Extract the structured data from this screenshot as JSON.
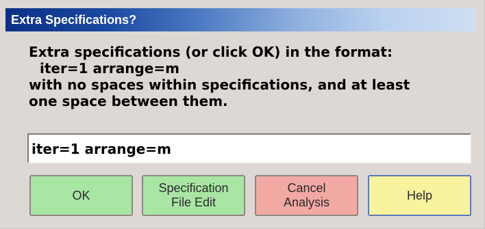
{
  "window": {
    "title": "Extra Specifications?"
  },
  "message": {
    "lines": [
      "Extra specifications (or click OK) in the format:",
      "iter=1 arrange=m",
      "with no spaces within specifications, and at least",
      "one space between them."
    ]
  },
  "input": {
    "value": "iter=1 arrange=m"
  },
  "buttons": {
    "ok": {
      "label": "OK",
      "color": "#a9e6a4"
    },
    "specification_file_edit": {
      "label_line1": "Specification",
      "label_line2": "File Edit",
      "color": "#a9e6a4"
    },
    "cancel_analysis": {
      "label_line1": "Cancel",
      "label_line2": "Analysis",
      "color": "#f2a9a4"
    },
    "help": {
      "label": "Help",
      "color": "#f8f39e"
    }
  },
  "colors": {
    "dialog_background": "#ddd8d3",
    "titlebar_start": "#0c2f86",
    "titlebar_end": "#cfdff4"
  }
}
